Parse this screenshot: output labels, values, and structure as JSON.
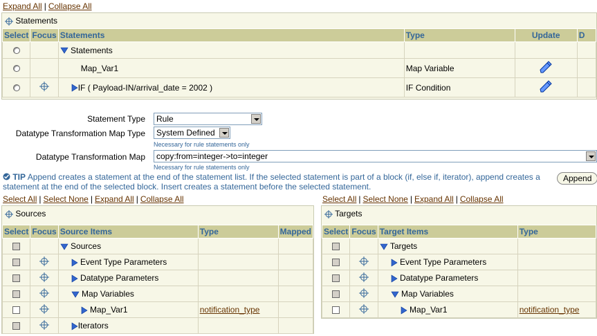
{
  "top_links": {
    "expand_all": "Expand All",
    "collapse_all": "Collapse All"
  },
  "statements_panel": {
    "title": "Statements",
    "columns": [
      "Select",
      "Focus",
      "Statements",
      "Type",
      "Update",
      "D"
    ],
    "rows": [
      {
        "label": "Statements",
        "type": ""
      },
      {
        "label": "Map_Var1",
        "type": "Map Variable"
      },
      {
        "label": "IF ( Payload-IN/arrival_date = 2002 )",
        "type": "IF Condition"
      }
    ]
  },
  "form": {
    "statement_type_label": "Statement Type",
    "statement_type_value": "Rule",
    "dt_map_type_label": "Datatype Transformation Map Type",
    "dt_map_type_value": "System Defined",
    "hint1": "Necessary for rule statements only",
    "dt_map_label": "Datatype Transformation Map",
    "dt_map_value": "copy:from=integer->to=integer",
    "hint2": "Necessary for rule statements only"
  },
  "tip": {
    "label": "TIP",
    "line1": "Append creates a statement at the end of the statement list. If the selected statement is part of a block (if, else if, iterator), append creates a",
    "line2": "statement at the end of the selected block. Insert creates a statement before the selected statement.",
    "append_button": "Append"
  },
  "list_links": {
    "select_all": "Select All",
    "select_none": "Select None",
    "expand_all": "Expand All",
    "collapse_all": "Collapse All"
  },
  "sources": {
    "title": "Sources",
    "columns": [
      "Select",
      "Focus",
      "Source Items",
      "Type",
      "Mapped"
    ],
    "rows": [
      {
        "label": "Sources",
        "type": ""
      },
      {
        "label": "Event Type Parameters",
        "type": ""
      },
      {
        "label": "Datatype Parameters",
        "type": ""
      },
      {
        "label": "Map Variables",
        "type": ""
      },
      {
        "label": "Map_Var1",
        "type": "notification_type"
      },
      {
        "label": "Iterators",
        "type": ""
      }
    ]
  },
  "targets": {
    "title": "Targets",
    "columns": [
      "Select",
      "Focus",
      "Target Items",
      "Type"
    ],
    "rows": [
      {
        "label": "Targets",
        "type": ""
      },
      {
        "label": "Event Type Parameters",
        "type": ""
      },
      {
        "label": "Datatype Parameters",
        "type": ""
      },
      {
        "label": "Map Variables",
        "type": ""
      },
      {
        "label": "Map_Var1",
        "type": "notification_type"
      }
    ]
  },
  "colors": {
    "header_bg": "#cccc99",
    "header_text": "#336699",
    "panel_bg": "#f7f7e7",
    "link": "#663300",
    "tree_arrow": "#3366cc"
  }
}
